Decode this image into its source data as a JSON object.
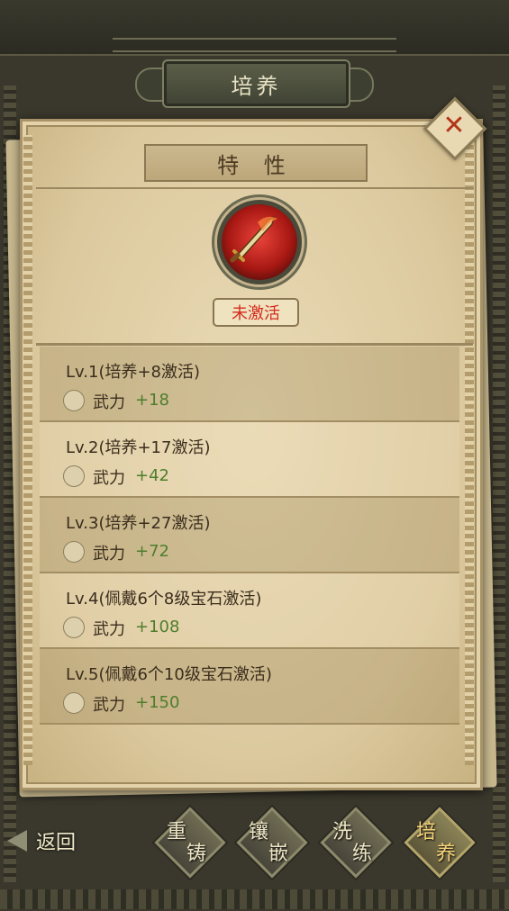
{
  "window": {
    "title": "培养"
  },
  "panel": {
    "section_title": "特 性",
    "status": "未激活"
  },
  "close": {
    "label": "✕"
  },
  "levels": [
    {
      "title": "Lv.1(培养+8激活)",
      "stat": "武力",
      "value": "+18"
    },
    {
      "title": "Lv.2(培养+17激活)",
      "stat": "武力",
      "value": "+42"
    },
    {
      "title": "Lv.3(培养+27激活)",
      "stat": "武力",
      "value": "+72"
    },
    {
      "title": "Lv.4(佩戴6个8级宝石激活)",
      "stat": "武力",
      "value": "+108"
    },
    {
      "title": "Lv.5(佩戴6个10级宝石激活)",
      "stat": "武力",
      "value": "+150"
    }
  ],
  "bottom": {
    "back": "返回",
    "tabs": [
      {
        "c1": "重",
        "c2": "铸"
      },
      {
        "c1": "镶",
        "c2": "嵌"
      },
      {
        "c1": "洗",
        "c2": "练"
      },
      {
        "c1": "培",
        "c2": "养"
      }
    ]
  },
  "icons": {
    "skill": "sword-icon",
    "stat": "crossed-swords-icon",
    "close": "close-icon",
    "back": "back-arrow-icon"
  },
  "colors": {
    "status_red": "#d52a1e",
    "value_green": "#4e7d2d",
    "close_red": "#b2341b"
  }
}
